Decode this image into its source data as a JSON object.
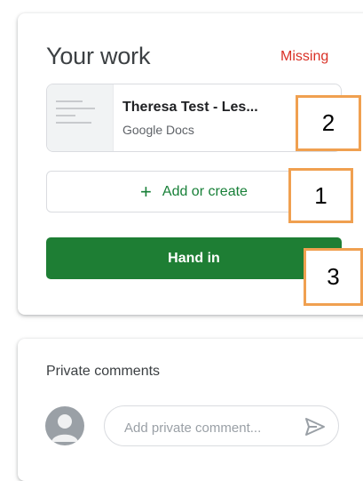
{
  "work": {
    "title": "Your work",
    "status": "Missing",
    "attachment": {
      "title": "Theresa Test - Les...",
      "type": "Google Docs"
    },
    "add_label": "Add or create",
    "add_icon": "plus-icon",
    "hand_in_label": "Hand in"
  },
  "callouts": [
    "1",
    "2",
    "3"
  ],
  "comments": {
    "title": "Private comments",
    "placeholder": "Add private comment...",
    "avatar_icon": "avatar-icon",
    "send_icon": "send-icon"
  },
  "colors": {
    "status_missing": "#d93025",
    "accent_green": "#188038",
    "hand_in_bg": "#1e7e34",
    "callout_border": "#f0a050"
  }
}
